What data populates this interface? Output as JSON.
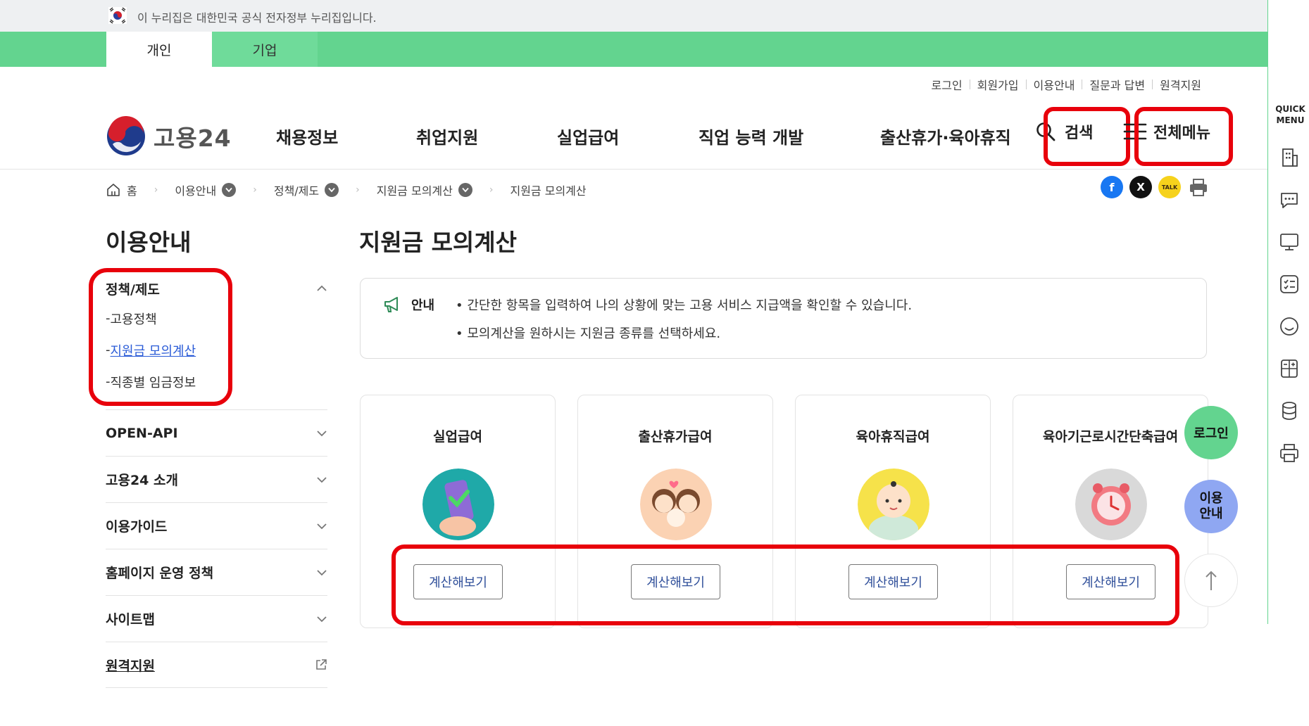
{
  "gov_banner": {
    "text": "이 누리집은 대한민국 공식 전자정부 누리집입니다."
  },
  "audience_tabs": [
    "개인",
    "기업"
  ],
  "utility_links": [
    "로그인",
    "회원가입",
    "이용안내",
    "질문과 답변",
    "원격지원"
  ],
  "logo": {
    "text": "고용24"
  },
  "gnb": [
    "채용정보",
    "취업지원",
    "실업급여",
    "직업 능력 개발",
    "출산휴가·육아휴직"
  ],
  "header_actions": {
    "search": "검색",
    "menu": "전체메뉴"
  },
  "breadcrumb": [
    "홈",
    "이용안내",
    "정책/제도",
    "지원금 모의계산",
    "지원금 모의계산"
  ],
  "share": {
    "facebook": "f",
    "x": "X",
    "kakao": "TALK"
  },
  "lnb": {
    "title": "이용안내",
    "open_section": "정책/제도",
    "sub_items": [
      "고용정책",
      "지원금 모의계산",
      "직종별 임금정보"
    ],
    "sections": [
      "OPEN-API",
      "고용24 소개",
      "이용가이드",
      "홈페이지 운영 정책",
      "사이트맵",
      "원격지원"
    ]
  },
  "page_title": "지원금 모의계산",
  "notice": {
    "label": "안내",
    "lines": [
      "간단한 항목을 입력하여 나의 상황에 맞는 고용 서비스 지급액을 확인할 수 있습니다.",
      "모의계산을 원하시는 지원금 종류를 선택하세요."
    ]
  },
  "cards": [
    {
      "title": "실업급여",
      "button": "계산해보기"
    },
    {
      "title": "출산휴가급여",
      "button": "계산해보기"
    },
    {
      "title": "육아휴직급여",
      "button": "계산해보기"
    },
    {
      "title": "육아기근로시간단축급여",
      "button": "계산해보기"
    }
  ],
  "floating": {
    "login": "로그인",
    "guide_line1": "이용",
    "guide_line2": "안내"
  },
  "quick_menu": {
    "title_line1": "QUICK",
    "title_line2": "MENU"
  },
  "colors": {
    "brand_green": "#63d48f",
    "highlight_red": "#e8000b",
    "link_blue": "#2a5bd7"
  }
}
